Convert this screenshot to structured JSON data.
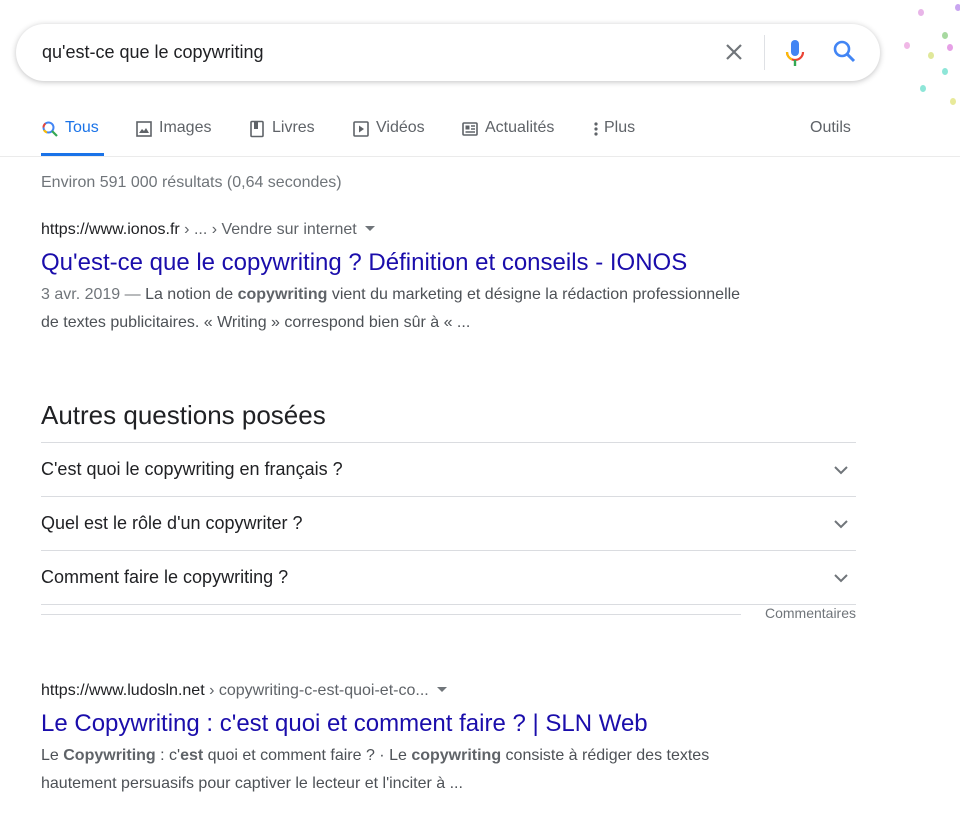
{
  "search": {
    "query": "qu'est-ce que le copywriting"
  },
  "tabs": [
    {
      "label": "Tous",
      "icon": "search-icon"
    },
    {
      "label": "Images",
      "icon": "image-icon"
    },
    {
      "label": "Livres",
      "icon": "book-icon"
    },
    {
      "label": "Vidéos",
      "icon": "play-icon"
    },
    {
      "label": "Actualités",
      "icon": "news-icon"
    },
    {
      "label": "Plus",
      "icon": "more-vert-icon"
    }
  ],
  "tools_label": "Outils",
  "stats": "Environ 591 000 résultats (0,64 secondes)",
  "results": [
    {
      "site": "https://www.ionos.fr",
      "crumb": " › ... › Vendre sur internet",
      "title": "Qu'est-ce que le copywriting ? Définition et conseils - IONOS",
      "date": "3 avr. 2019 — ",
      "s1": "La notion de ",
      "b1": "copywriting",
      "s2": " vient du marketing et désigne la rédaction professionnelle de textes publicitaires. « Writing » correspond bien sûr à « ..."
    },
    {
      "site": "https://www.ludosln.net",
      "crumb": " › copywriting-c-est-quoi-et-co...",
      "title": "Le Copywriting : c'est quoi et comment faire ? | SLN Web",
      "s1": "Le ",
      "b1": "Copywriting",
      "s2": " : c'",
      "b2": "est",
      "s3": " quoi et comment faire ? · Le ",
      "b3": "copywriting",
      "s4": " consiste à rédiger des textes hautement persuasifs pour captiver le lecteur et l'inciter à ..."
    }
  ],
  "paa": {
    "heading": "Autres questions posées",
    "questions": [
      "C'est quoi le copywriting en français ?",
      "Quel est le rôle d'un copywriter ?",
      "Comment faire le copywriting ?"
    ]
  },
  "feedback": "Commentaires",
  "colors": {
    "link": "#1a0dab",
    "accent": "#1a73e8"
  }
}
